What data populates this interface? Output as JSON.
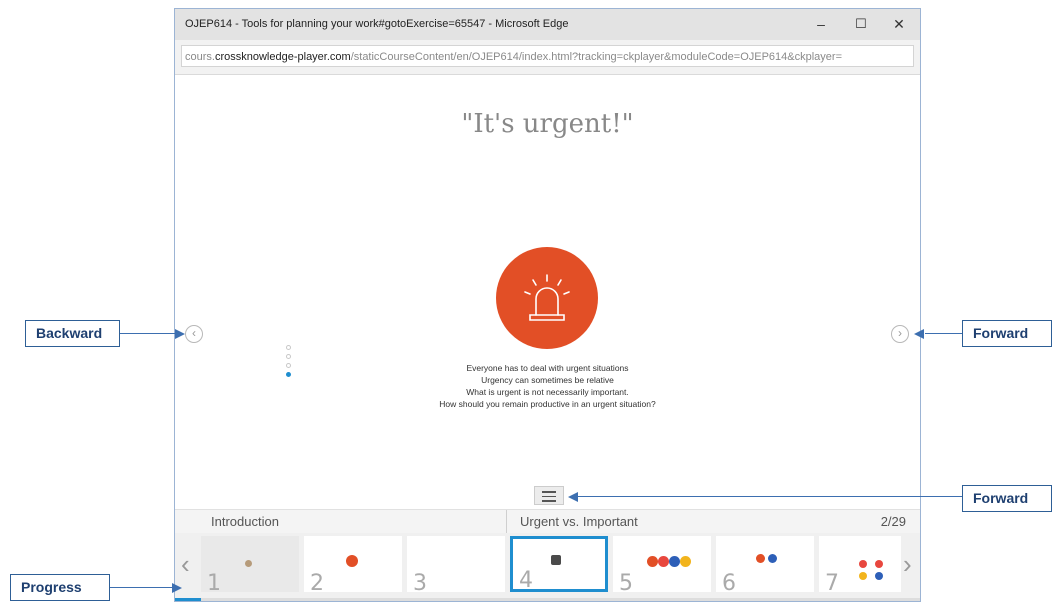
{
  "window": {
    "title": "OJEP614 - Tools for planning your work#gotoExercise=65547 - Microsoft Edge",
    "minimize": "–",
    "maximize": "☐",
    "close": "✕"
  },
  "address": {
    "prefix": "cours.",
    "domain": "crossknowledge-player.com",
    "path": "/staticCourseContent/en/OJEP614/index.html?tracking=ckplayer&moduleCode=OJEP614&ckplayer="
  },
  "slide": {
    "heading": "\"It's urgent!\"",
    "lines": [
      "Everyone has to deal with urgent situations",
      "Urgency can sometimes be relative",
      "What is urgent is not necessarily important.",
      "How should you remain productive in an urgent situation?"
    ],
    "icon": "siren-icon",
    "accent": "#e24f26"
  },
  "nav": {
    "back_glyph": "‹",
    "forward_glyph": "›",
    "menu_icon": "hamburger-icon",
    "step_dots": 4,
    "active_dot": 3
  },
  "sections": {
    "left": "Introduction",
    "right": "Urgent vs. Important",
    "counter": "2/29"
  },
  "thumbnails": {
    "numbers": [
      "1",
      "2",
      "3",
      "4",
      "5",
      "6",
      "7"
    ],
    "selected": "4",
    "prev_glyph": "‹",
    "next_glyph": "›"
  },
  "progress": {
    "fraction": 0.0345,
    "color": "#1f8ecf"
  },
  "callouts": {
    "backward": "Backward",
    "forward_right": "Forward",
    "forward_menu": "Forward",
    "progress": "Progress",
    "color": "#2e5f96"
  }
}
